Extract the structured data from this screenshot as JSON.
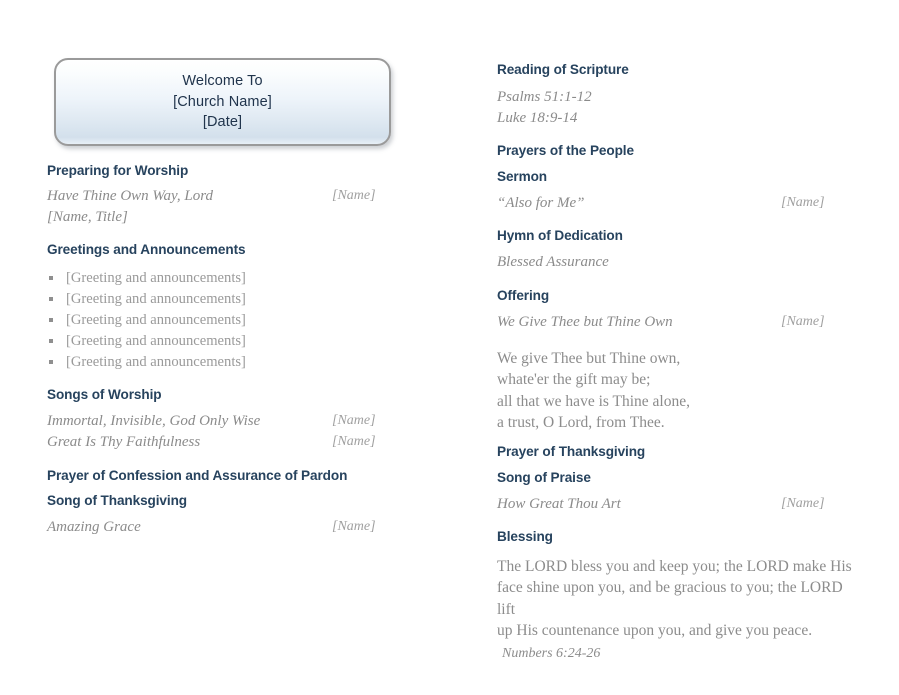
{
  "document": {
    "type": "church-bulletin",
    "colors": {
      "heading": "#27435e",
      "body": "#8b8b8b",
      "banner_text": "#20344c",
      "banner_border": "#9a9a9a",
      "page_background": "#ffffff"
    }
  },
  "banner": {
    "line1": "Welcome To",
    "line2": "[Church Name]",
    "line3": "[Date]"
  },
  "left_column": {
    "preparing": {
      "heading": "Preparing for Worship",
      "song_title": "Have Thine Own Way, Lord",
      "song_name": "[Name]",
      "credit": "[Name, Title]"
    },
    "greetings": {
      "heading": "Greetings and Announcements",
      "items": [
        "[Greeting and announcements]",
        "[Greeting and announcements]",
        "[Greeting and announcements]",
        "[Greeting and announcements]",
        "[Greeting and announcements]"
      ]
    },
    "songs_of_worship": {
      "heading": "Songs of Worship",
      "songs": [
        {
          "title": "Immortal, Invisible, God Only Wise",
          "name": "[Name]"
        },
        {
          "title": "Great Is Thy Faithfulness",
          "name": "[Name]"
        }
      ]
    },
    "prayer_of_confession": {
      "heading": "Prayer of Confession and Assurance of Pardon"
    },
    "song_of_thanksgiving": {
      "heading": "Song of Thanksgiving",
      "song_title": "Amazing Grace",
      "song_name": "[Name]"
    }
  },
  "right_column": {
    "reading_of_scripture": {
      "heading": "Reading of Scripture",
      "passages": [
        "Psalms 51:1-12",
        "Luke 18:9-14"
      ]
    },
    "prayers_of_the_people": {
      "heading": "Prayers of the People"
    },
    "sermon": {
      "heading": "Sermon",
      "title": "“Also for Me”",
      "name": "[Name]"
    },
    "hymn_of_dedication": {
      "heading": "Hymn of Dedication",
      "title": "Blessed Assurance"
    },
    "offering": {
      "heading": "Offering",
      "title": "We Give Thee but Thine Own",
      "name": "[Name]",
      "verse_lines": [
        "We give Thee but Thine own,",
        "whate'er the gift may be;",
        "all that we have is Thine alone,",
        "a trust, O Lord, from Thee."
      ]
    },
    "prayer_of_thanksgiving": {
      "heading": "Prayer of Thanksgiving"
    },
    "song_of_praise": {
      "heading": "Song of Praise",
      "title": "How Great Thou Art",
      "name": "[Name]"
    },
    "blessing": {
      "heading": "Blessing",
      "text_lines": [
        "The LORD bless you and keep you; the LORD make His",
        "face shine upon you, and be gracious to you; the LORD lift",
        "up His countenance upon you, and give you peace."
      ],
      "citation": "Numbers 6:24-26"
    }
  }
}
